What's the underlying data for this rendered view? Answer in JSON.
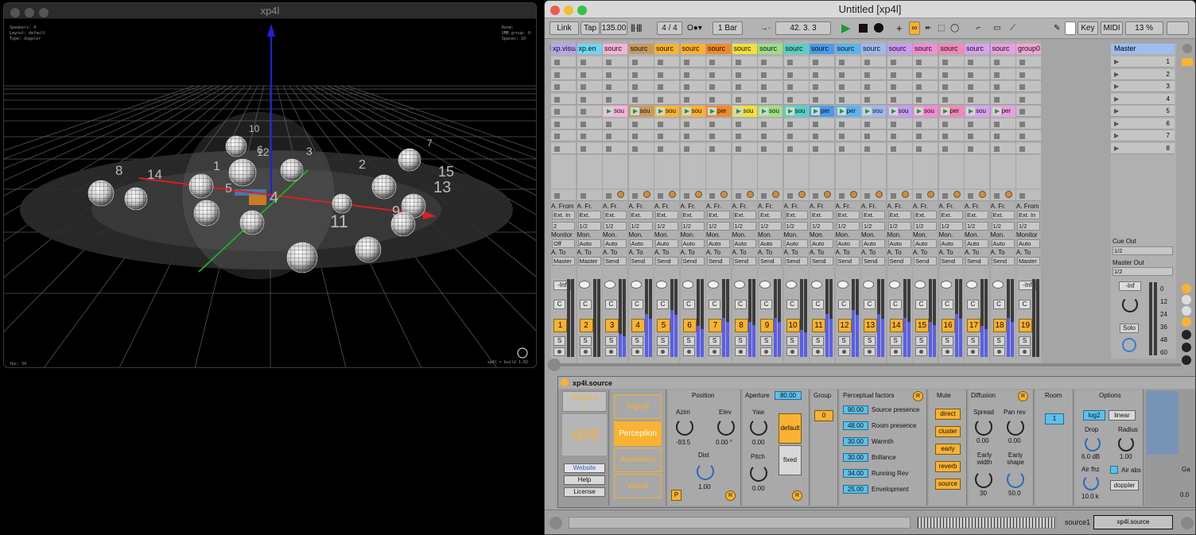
{
  "left_window": {
    "title": "xp4l",
    "info_left": [
      "Speakers: 4",
      "Layout: default",
      "Type: doppler"
    ],
    "info_right": [
      "Room:",
      "UMB group: 0",
      "Spaces: 10"
    ],
    "fps": "fps: 34",
    "build": "xp4l • build 1.02",
    "speaker_labels": [
      "10",
      "12",
      "6",
      "3",
      "1",
      "2",
      "7",
      "8",
      "14",
      "15",
      "13",
      "5",
      "4",
      "11",
      "9"
    ]
  },
  "ableton": {
    "title": "Untitled  [xp4l]",
    "toolbar": {
      "link": "Link",
      "tap": "Tap",
      "tempo": "135.00",
      "signature": "4 / 4",
      "quantize": "1 Bar",
      "position": "42.  3.  3",
      "key": "Key",
      "midi": "MIDI",
      "cpu": "13 %"
    },
    "tracks": [
      {
        "name": "xp.visual",
        "color": "#b9a4f0",
        "num": "1",
        "clip": ""
      },
      {
        "name": "xp.en",
        "color": "#6fd6f2",
        "num": "2",
        "clip": ""
      },
      {
        "name": "sourc",
        "color": "#f3b4d8",
        "num": "3",
        "clip": "sou"
      },
      {
        "name": "sourc",
        "color": "#c99a5f",
        "num": "4",
        "clip": "sou"
      },
      {
        "name": "sourc",
        "color": "#f9b232",
        "num": "5",
        "clip": "sou"
      },
      {
        "name": "sourc",
        "color": "#f9b232",
        "num": "6",
        "clip": "sou"
      },
      {
        "name": "sourc",
        "color": "#f08a2b",
        "num": "7",
        "clip": "per"
      },
      {
        "name": "sourc",
        "color": "#f3e03a",
        "num": "8",
        "clip": "sou"
      },
      {
        "name": "sourc",
        "color": "#9ee086",
        "num": "9",
        "clip": "sou"
      },
      {
        "name": "sourc",
        "color": "#58d0c4",
        "num": "10",
        "clip": "sou"
      },
      {
        "name": "sourc",
        "color": "#4a9be8",
        "num": "11",
        "clip": "per"
      },
      {
        "name": "sourc",
        "color": "#5ab4ee",
        "num": "12",
        "clip": "per"
      },
      {
        "name": "sourc",
        "color": "#9fb8f0",
        "num": "13",
        "clip": "sou"
      },
      {
        "name": "sourc",
        "color": "#c89cf0",
        "num": "14",
        "clip": "sou"
      },
      {
        "name": "sourc",
        "color": "#f28cd4",
        "num": "15",
        "clip": "sou"
      },
      {
        "name": "sourc",
        "color": "#f08ab8",
        "num": "16",
        "clip": "per"
      },
      {
        "name": "sourc",
        "color": "#d9a3f0",
        "num": "17",
        "clip": "sou"
      },
      {
        "name": "sourc",
        "color": "#e8a0e0",
        "num": "18",
        "clip": "per"
      },
      {
        "name": "group0",
        "color": "#f3a5d5",
        "num": "19",
        "clip": ""
      }
    ],
    "io": {
      "audio_from": "A. From",
      "audio_fr": "A. Fr.",
      "ext_in": "Ext. In",
      "ext": "Ext.",
      "ch2": "2",
      "ch12": "1/2",
      "monitor": "Monitor",
      "mon": "Mon.",
      "off": "Off",
      "auto": "Auto",
      "audio_to": "A. To",
      "master": "Master",
      "send": "Send",
      "inf": "-Inf",
      "c": "C",
      "s": "S"
    },
    "master": {
      "name": "Master",
      "scenes": [
        "1",
        "2",
        "3",
        "4",
        "5",
        "6",
        "7",
        "8"
      ],
      "cue_out": "Cue Out",
      "cue_val": "1/2",
      "master_out": "Master Out",
      "master_val": "1/2",
      "inf": "-Inf",
      "solo": "Solo",
      "db_scale": [
        "0",
        "12",
        "24",
        "36",
        "48",
        "60"
      ]
    },
    "device": {
      "title": "xp4l.source",
      "source_label": "SOURCE",
      "source_num": "1",
      "logo": "xp4l",
      "website": "Website",
      "help": "Help",
      "license": "License",
      "tabs": [
        "Signal",
        "Perception",
        "Animation",
        "Visual"
      ],
      "position": {
        "title": "Position",
        "azim": "Azim",
        "elev": "Elev",
        "dist": "Dist",
        "azim_val": "-93.5",
        "elev_val": "0.00 °",
        "dist_val": "1.00",
        "p": "P",
        "r": "R"
      },
      "aperture": {
        "title": "Aperture",
        "value": "80.00",
        "yaw": "Yaw",
        "yaw_val": "0.00",
        "pitch": "Pitch",
        "pitch_val": "0.00",
        "default": "default",
        "fixed": "fixed",
        "r": "R"
      },
      "group": {
        "title": "Group",
        "value": "0"
      },
      "perceptual": {
        "title": "Perceptual factors",
        "r": "R",
        "rows": [
          {
            "value": "90.00",
            "label": "Source presence"
          },
          {
            "value": "48.00",
            "label": "Room presence"
          },
          {
            "value": "30.00",
            "label": "Warmth"
          },
          {
            "value": "30.00",
            "label": "Brillance"
          },
          {
            "value": "34.00",
            "label": "Running Rev"
          },
          {
            "value": "25.00",
            "label": "Envelopment"
          }
        ]
      },
      "mute": {
        "title": "Mute",
        "items": [
          "direct",
          "cluster",
          "early",
          "reverb",
          "source"
        ]
      },
      "diffusion": {
        "title": "Diffusion",
        "r": "R",
        "spread": "Spread",
        "spread_val": "0.00",
        "panrev": "Pan rev",
        "panrev_val": "0.00",
        "ew": "Early width",
        "ew_val": "30",
        "es": "Early shape",
        "es_val": "50.0"
      },
      "room": {
        "title": "Room",
        "value": "1"
      },
      "options": {
        "title": "Options",
        "log2": "log2",
        "linear": "linear",
        "drop": "Drop",
        "drop_val": "6.0 dB",
        "radius": "Radius",
        "radius_val": "1.00",
        "airfhz": "Air fhz",
        "airfhz_val": "10.0 k",
        "airabs": "Air abs",
        "doppler": "doppler",
        "ga": "Ga",
        "ga_val": "0.0"
      }
    },
    "status": {
      "track": "source1",
      "device": "xp4l.source"
    }
  }
}
